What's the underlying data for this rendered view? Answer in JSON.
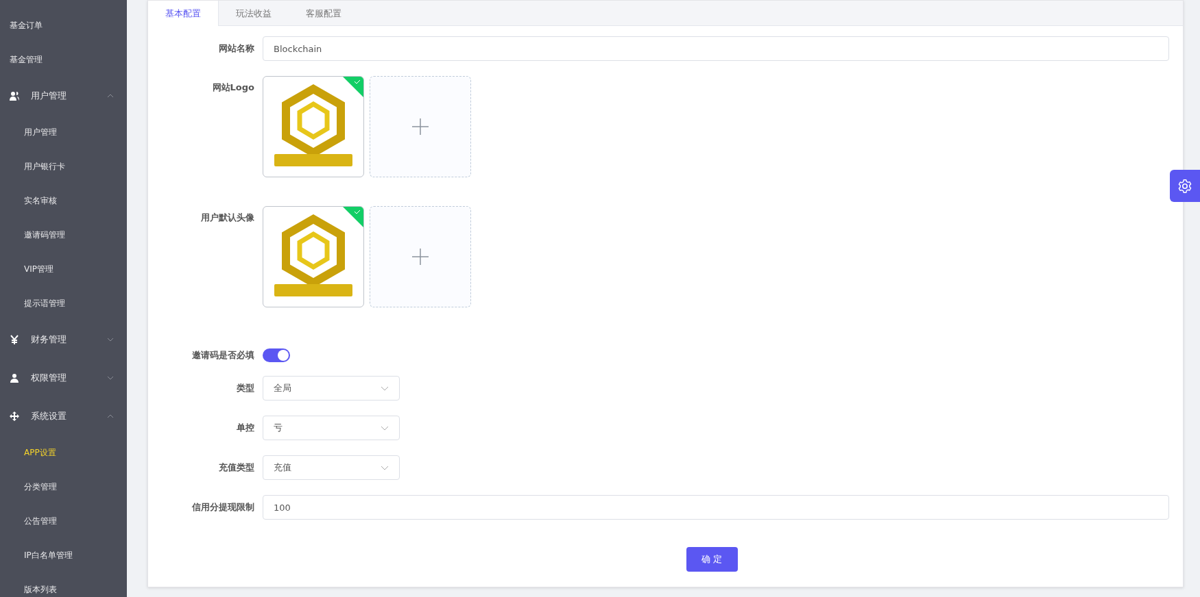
{
  "sidebar": {
    "items": [
      {
        "kind": "item",
        "label": "基金订单",
        "selected": false
      },
      {
        "kind": "item",
        "label": "基金管理",
        "selected": false
      },
      {
        "kind": "group",
        "label": "用户管理",
        "expanded": true,
        "children": [
          {
            "kind": "item",
            "label": "用户管理",
            "selected": false
          },
          {
            "kind": "item",
            "label": "用户银行卡",
            "selected": false
          },
          {
            "kind": "item",
            "label": "实名审核",
            "selected": false
          },
          {
            "kind": "item",
            "label": "邀请码管理",
            "selected": false
          },
          {
            "kind": "item",
            "label": "VIP管理",
            "selected": false
          },
          {
            "kind": "item",
            "label": "提示语管理",
            "selected": false
          }
        ]
      },
      {
        "kind": "group",
        "label": "财务管理",
        "expanded": false
      },
      {
        "kind": "group",
        "label": "权限管理",
        "expanded": false
      },
      {
        "kind": "group",
        "label": "系统设置",
        "expanded": true,
        "children": [
          {
            "kind": "item",
            "label": "APP设置",
            "selected": true
          },
          {
            "kind": "item",
            "label": "分类管理",
            "selected": false
          },
          {
            "kind": "item",
            "label": "公告管理",
            "selected": false
          },
          {
            "kind": "item",
            "label": "IP白名单管理",
            "selected": false
          },
          {
            "kind": "item",
            "label": "版本列表",
            "selected": false
          }
        ]
      }
    ]
  },
  "tabs": [
    {
      "label": "基本配置",
      "selected": true
    },
    {
      "label": "玩法收益",
      "selected": false
    },
    {
      "label": "客服配置",
      "selected": false
    }
  ],
  "form": {
    "fields": [
      {
        "kind": "text",
        "label": "网站名称",
        "value": "Blockchain"
      },
      {
        "kind": "upload",
        "label": "网站Logo",
        "uploaded": true
      },
      {
        "kind": "upload",
        "label": "用户默认头像",
        "uploaded": true
      },
      {
        "kind": "switch",
        "label": "邀请码是否必填",
        "on": true
      },
      {
        "kind": "select",
        "label": "类型",
        "value": "全局"
      },
      {
        "kind": "select",
        "label": "单控",
        "value": "亏"
      },
      {
        "kind": "select",
        "label": "充值类型",
        "value": "充值"
      },
      {
        "kind": "text",
        "label": "信用分提现限制",
        "value": "100"
      }
    ],
    "submit": "确 定"
  }
}
